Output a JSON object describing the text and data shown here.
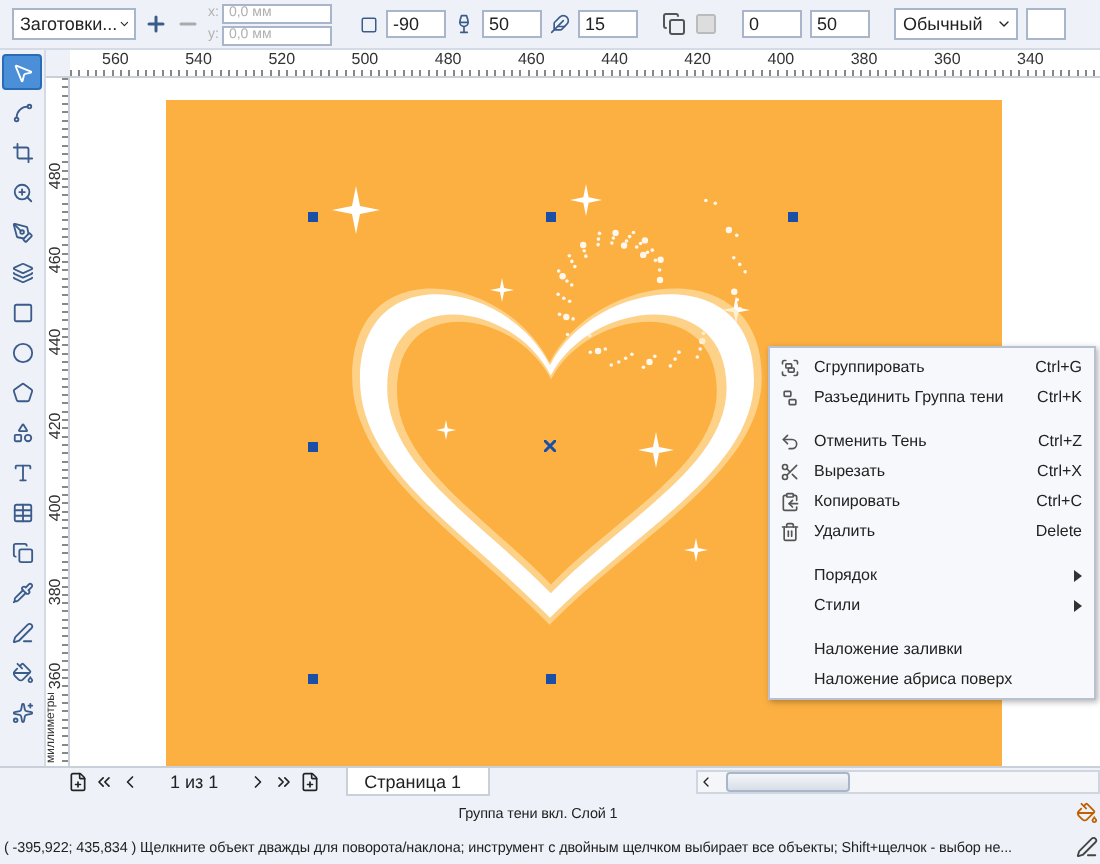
{
  "toolbar": {
    "preset": "Заготовки...",
    "x_label": "x:",
    "x_value": "0,0 мм",
    "y_label": "y:",
    "y_value": "0,0 мм",
    "position_disabled": true,
    "angle": "-90",
    "opacity": "50",
    "feather": "15",
    "fade": "0",
    "stretch": "50",
    "merge_mode": "Обычный"
  },
  "toolbox": [
    {
      "selected": true
    },
    {
      "selected": false
    },
    {
      "selected": false
    },
    {
      "selected": false
    },
    {
      "selected": false
    },
    {
      "selected": false
    },
    {
      "selected": false
    },
    {
      "selected": false
    },
    {
      "selected": false
    },
    {
      "selected": false
    },
    {
      "selected": false
    },
    {
      "selected": false
    },
    {
      "selected": false
    },
    {
      "selected": false
    },
    {
      "selected": false
    },
    {
      "selected": false
    },
    {
      "selected": false
    }
  ],
  "ruler": {
    "horizontal": [
      "560",
      "540",
      "520",
      "500",
      "480",
      "460",
      "440",
      "420",
      "400",
      "380",
      "360",
      "340"
    ],
    "vertical": [
      "480",
      "460",
      "440",
      "420",
      "400",
      "380",
      "360"
    ],
    "unit": "миллиметры"
  },
  "context_menu": [
    {
      "kind": "action",
      "label": "Сгруппировать",
      "shortcut": "Ctrl+G"
    },
    {
      "kind": "action",
      "label": "Разъединить Группа тени",
      "shortcut": "Ctrl+K"
    },
    {
      "kind": "separator"
    },
    {
      "kind": "action",
      "label": "Отменить Тень",
      "shortcut": "Ctrl+Z"
    },
    {
      "kind": "action",
      "label": "Вырезать",
      "shortcut": "Ctrl+X"
    },
    {
      "kind": "action",
      "label": "Копировать",
      "shortcut": "Ctrl+C"
    },
    {
      "kind": "action",
      "label": "Удалить",
      "shortcut": "Delete"
    },
    {
      "kind": "separator"
    },
    {
      "kind": "submenu",
      "label": "Порядок"
    },
    {
      "kind": "submenu",
      "label": "Стили"
    },
    {
      "kind": "separator"
    },
    {
      "kind": "plain",
      "label": "Наложение заливки"
    },
    {
      "kind": "plain",
      "label": "Наложение абриса поверх"
    }
  ],
  "page_bar": {
    "page_count": "1 из 1",
    "tabs": [
      {
        "label": "Страница 1",
        "selected": true
      }
    ]
  },
  "status_bar": {
    "selection": "Группа тени вкл. Слой 1",
    "coordinates": "( -395,922; 435,834 )",
    "hint": "Щелкните объект дважды для поворота/наклона; инструмент с двойным щелчком выбирает все объекты; Shift+щелчок - выбор не..."
  }
}
